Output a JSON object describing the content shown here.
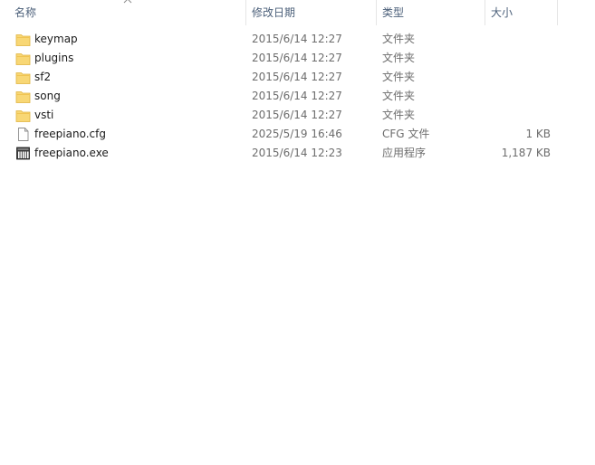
{
  "columns": {
    "name": "名称",
    "date": "修改日期",
    "type": "类型",
    "size": "大小"
  },
  "files": [
    {
      "name": "keymap",
      "date": "2015/6/14 12:27",
      "type": "文件夹",
      "size": "",
      "icon": "folder-icon"
    },
    {
      "name": "plugins",
      "date": "2015/6/14 12:27",
      "type": "文件夹",
      "size": "",
      "icon": "folder-icon"
    },
    {
      "name": "sf2",
      "date": "2015/6/14 12:27",
      "type": "文件夹",
      "size": "",
      "icon": "folder-icon"
    },
    {
      "name": "song",
      "date": "2015/6/14 12:27",
      "type": "文件夹",
      "size": "",
      "icon": "folder-icon"
    },
    {
      "name": "vsti",
      "date": "2015/6/14 12:27",
      "type": "文件夹",
      "size": "",
      "icon": "folder-icon"
    },
    {
      "name": "freepiano.cfg",
      "date": "2025/5/19 16:46",
      "type": "CFG 文件",
      "size": "1 KB",
      "icon": "document-icon"
    },
    {
      "name": "freepiano.exe",
      "date": "2015/6/14 12:23",
      "type": "应用程序",
      "size": "1,187 KB",
      "icon": "application-icon"
    }
  ],
  "colors": {
    "header_text": "#4c607a",
    "folder_yellow": "#f8d775",
    "secondary_text": "#6d6d6d"
  }
}
